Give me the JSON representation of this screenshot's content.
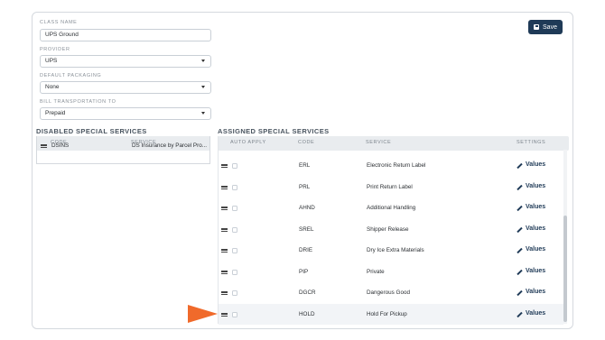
{
  "form": {
    "class_name_label": "CLASS NAME",
    "class_name_value": "UPS Ground",
    "provider_label": "PROVIDER",
    "provider_value": "UPS",
    "default_packaging_label": "DEFAULT PACKAGING",
    "default_packaging_value": "None",
    "bill_transportation_label": "BILL TRANSPORTATION TO",
    "bill_transportation_value": "Prepaid"
  },
  "toolbar": {
    "save_label": "Save"
  },
  "disabled": {
    "title": "DISABLED SPECIAL SERVICES",
    "col_code": "CODE",
    "col_service": "SERVICE",
    "rows": [
      {
        "code": "DSINS",
        "service": "DS Insurance by Parcel Pro..."
      }
    ]
  },
  "assigned": {
    "title": "ASSIGNED SPECIAL SERVICES",
    "col_auto": "AUTO APPLY",
    "col_code": "CODE",
    "col_service": "SERVICE",
    "col_settings": "SETTINGS",
    "values_label": "Values",
    "rows": [
      {
        "code": "ERL",
        "service": "Electronic Return Label"
      },
      {
        "code": "PRL",
        "service": "Print Return Label"
      },
      {
        "code": "AHND",
        "service": "Additional Handling"
      },
      {
        "code": "SREL",
        "service": "Shipper Release"
      },
      {
        "code": "DRIE",
        "service": "Dry Ice Extra Materials"
      },
      {
        "code": "PIP",
        "service": "Private"
      },
      {
        "code": "DGCR",
        "service": "Dangerous Good"
      },
      {
        "code": "HOLD",
        "service": "Hold For Pickup"
      }
    ]
  },
  "colors": {
    "accent": "#1f3a57",
    "arrow": "#f06a2b"
  }
}
